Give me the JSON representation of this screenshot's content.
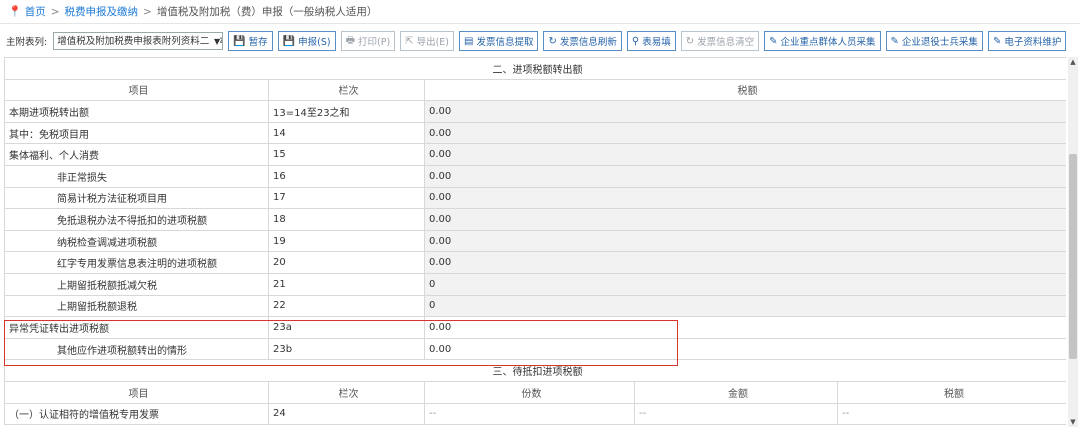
{
  "breadcrumb": {
    "home": "首页",
    "level1": "税费申报及缴纳",
    "level2": "增值税及附加税（费）申报（一般纳税人适用）",
    "separator": ">"
  },
  "toolbar": {
    "label": "主附表列:",
    "select_value": "增值税及附加税费申报表附列资料二（本",
    "buttons": [
      {
        "label": "暂存",
        "icon": "save-icon",
        "enabled": true
      },
      {
        "label": "申报(S)",
        "icon": "submit-icon",
        "enabled": true
      },
      {
        "label": "打印(P)",
        "icon": "print-icon",
        "enabled": false
      },
      {
        "label": "导出(E)",
        "icon": "export-icon",
        "enabled": false
      },
      {
        "label": "发票信息提取",
        "icon": "invoice-extract-icon",
        "enabled": true
      },
      {
        "label": "发票信息刷新",
        "icon": "refresh-icon",
        "enabled": true
      },
      {
        "label": "表易填",
        "icon": "search-icon",
        "enabled": true
      },
      {
        "label": "发票信息清空",
        "icon": "refresh-icon",
        "enabled": false
      },
      {
        "label": "企业重点群体人员采集",
        "icon": "edit-icon",
        "enabled": true
      },
      {
        "label": "企业退役士兵采集",
        "icon": "edit-icon",
        "enabled": true
      },
      {
        "label": "电子资料维护",
        "icon": "edit-icon",
        "enabled": true
      }
    ]
  },
  "section2": {
    "title": "二、进项税额转出额",
    "headers": [
      "项目",
      "栏次",
      "税额"
    ],
    "rows": [
      {
        "item": "本期进项税转出额",
        "col": "13=14至23之和",
        "value": "0.00",
        "indent": false
      },
      {
        "item": "其中：免税项目用",
        "col": "14",
        "value": "0.00",
        "indent": false
      },
      {
        "item": "集体福利、个人消费",
        "col": "15",
        "value": "0.00",
        "indent": false
      },
      {
        "item": "非正常损失",
        "col": "16",
        "value": "0.00",
        "indent": true
      },
      {
        "item": "简易计税方法征税项目用",
        "col": "17",
        "value": "0.00",
        "indent": true
      },
      {
        "item": "免抵退税办法不得抵扣的进项税额",
        "col": "18",
        "value": "0.00",
        "indent": true
      },
      {
        "item": "纳税检查调减进项税额",
        "col": "19",
        "value": "0.00",
        "indent": true
      },
      {
        "item": "红字专用发票信息表注明的进项税额",
        "col": "20",
        "value": "0.00",
        "indent": true
      },
      {
        "item": "上期留抵税额抵减欠税",
        "col": "21",
        "value": "0",
        "indent": true
      },
      {
        "item": "上期留抵税额退税",
        "col": "22",
        "value": "0",
        "indent": true
      },
      {
        "item": "异常凭证转出进项税额",
        "col": "23a",
        "value": "0.00",
        "indent": false
      },
      {
        "item": "其他应作进项税额转出的情形",
        "col": "23b",
        "value": "0.00",
        "indent": true
      }
    ]
  },
  "section3": {
    "title": "三、待抵扣进项税额",
    "headers": [
      "项目",
      "栏次",
      "份数",
      "金额",
      "税额"
    ],
    "rows": [
      {
        "item": "（一）认证相符的增值税专用发票",
        "col": "24",
        "count": "--",
        "amount": "--",
        "tax": "--"
      }
    ]
  }
}
